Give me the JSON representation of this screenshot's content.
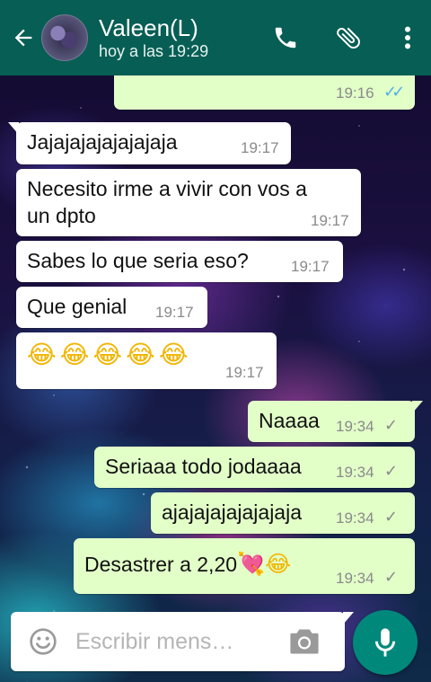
{
  "header": {
    "contact_name": "Valeen(L)",
    "status": "hoy a las 19:29",
    "icons": [
      "back-arrow-icon",
      "phone-icon",
      "paperclip-icon",
      "more-vert-icon"
    ]
  },
  "messages": [
    {
      "dir": "out",
      "text": "",
      "time": "19:16",
      "ticks": "✓✓",
      "read": true
    },
    {
      "dir": "in",
      "text": "Jajajajajajajajaja",
      "time": "19:17"
    },
    {
      "dir": "in",
      "text": "Necesito irme a vivir con vos a",
      "text2": "un dpto",
      "time": "19:17"
    },
    {
      "dir": "in",
      "text": "Sabes lo que seria eso?",
      "time": "19:17"
    },
    {
      "dir": "in",
      "text": "Que genial",
      "time": "19:17"
    },
    {
      "dir": "in",
      "text": "😂😂😂😂😂",
      "time": "19:17"
    },
    {
      "dir": "out",
      "text": "Naaaa",
      "time": "19:34",
      "ticks": "✓"
    },
    {
      "dir": "out",
      "text": "Seriaaa todo jodaaaa",
      "time": "19:34",
      "ticks": "✓"
    },
    {
      "dir": "out",
      "text": "ajajajajajajajaja",
      "time": "19:34",
      "ticks": "✓"
    },
    {
      "dir": "out",
      "text": "Desastrer a 2,20",
      "emoji": "💘😂",
      "time": "19:34",
      "ticks": "✓"
    }
  ],
  "composer": {
    "placeholder": "Escribir mens…",
    "icons": [
      "smiley-icon",
      "camera-icon",
      "microphone-icon"
    ]
  },
  "colors": {
    "header": "#075e54",
    "outgoing_bubble": "#e2ffc8",
    "incoming_bubble": "#ffffff",
    "read_tick": "#4fb0e6",
    "mic_button": "#00897b"
  }
}
